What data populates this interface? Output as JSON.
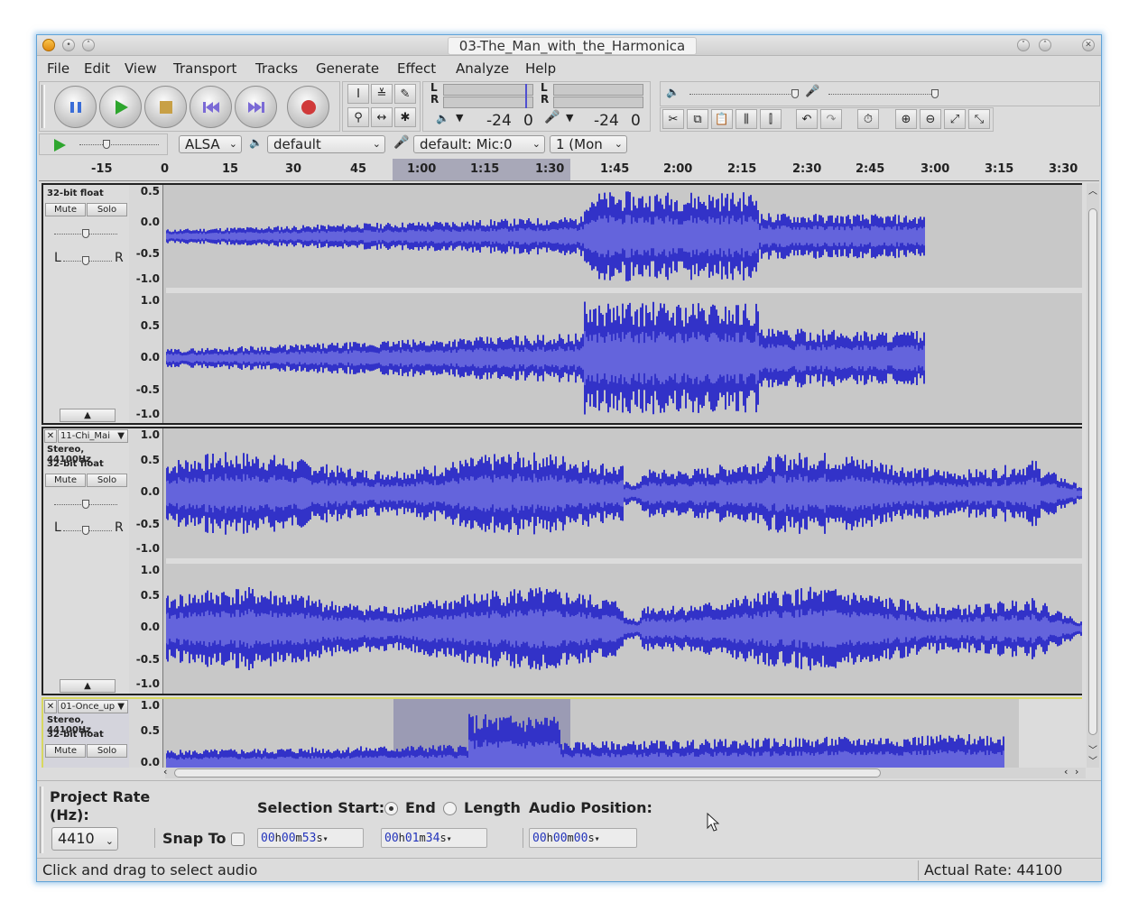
{
  "window": {
    "title": "03-The_Man_with_the_Harmonica"
  },
  "menu": [
    "File",
    "Edit",
    "View",
    "Transport",
    "Tracks",
    "Generate",
    "Effect",
    "Analyze",
    "Help"
  ],
  "transport": {
    "pause": "pause",
    "play": "play",
    "stop": "stop",
    "skip_start": "skip-start",
    "skip_end": "skip-end",
    "record": "record"
  },
  "meters": {
    "lr_top": "L\nR",
    "db1": "-24",
    "zero1": "0",
    "db2": "-24",
    "zero2": "0"
  },
  "device": {
    "host": "ALSA",
    "output": "default",
    "input": "default: Mic:0",
    "channels": "1 (Mon"
  },
  "ruler_ticks": [
    "-15",
    "0",
    "15",
    "30",
    "45",
    "1:00",
    "1:15",
    "1:30",
    "1:45",
    "2:00",
    "2:15",
    "2:30",
    "2:45",
    "3:00",
    "3:15",
    "3:30"
  ],
  "tracks": [
    {
      "name": "",
      "info1": "",
      "info2": "32-bit float",
      "mute": "Mute",
      "solo": "Solo",
      "pan_l": "L",
      "pan_r": "R"
    },
    {
      "name": "11-Chi_Mai",
      "info1": "Stereo, 44100Hz",
      "info2": "32-bit float",
      "mute": "Mute",
      "solo": "Solo",
      "pan_l": "L",
      "pan_r": "R"
    },
    {
      "name": "01-Once_up",
      "info1": "Stereo, 44100Hz",
      "info2": "32-bit float",
      "mute": "Mute",
      "solo": "Solo"
    }
  ],
  "scale": {
    "p1": "1.0",
    "p05": "0.5",
    "z": "0.0",
    "m05": "-0.5",
    "m1": "-1.0"
  },
  "bottom": {
    "project_rate_label": "Project Rate (Hz):",
    "project_rate": "4410",
    "snap_to": "Snap To",
    "selection_start": "Selection Start:",
    "end": "End",
    "length": "Length",
    "audio_position": "Audio Position:",
    "start_h": "00",
    "start_m": "00",
    "start_s": "53",
    "end_h": "00",
    "end_m": "01",
    "end_s": "34",
    "pos_h": "00",
    "pos_m": "00",
    "pos_s": "00",
    "h": "h",
    "m": "m",
    "s": "s"
  },
  "status": {
    "left": "Click and drag to select audio",
    "right": "Actual Rate: 44100"
  },
  "colors": {
    "wave": "#3232c8",
    "wave_rms": "#6464dc",
    "track_bg": "#c8c8c8",
    "selection": "#9b9bb4"
  }
}
